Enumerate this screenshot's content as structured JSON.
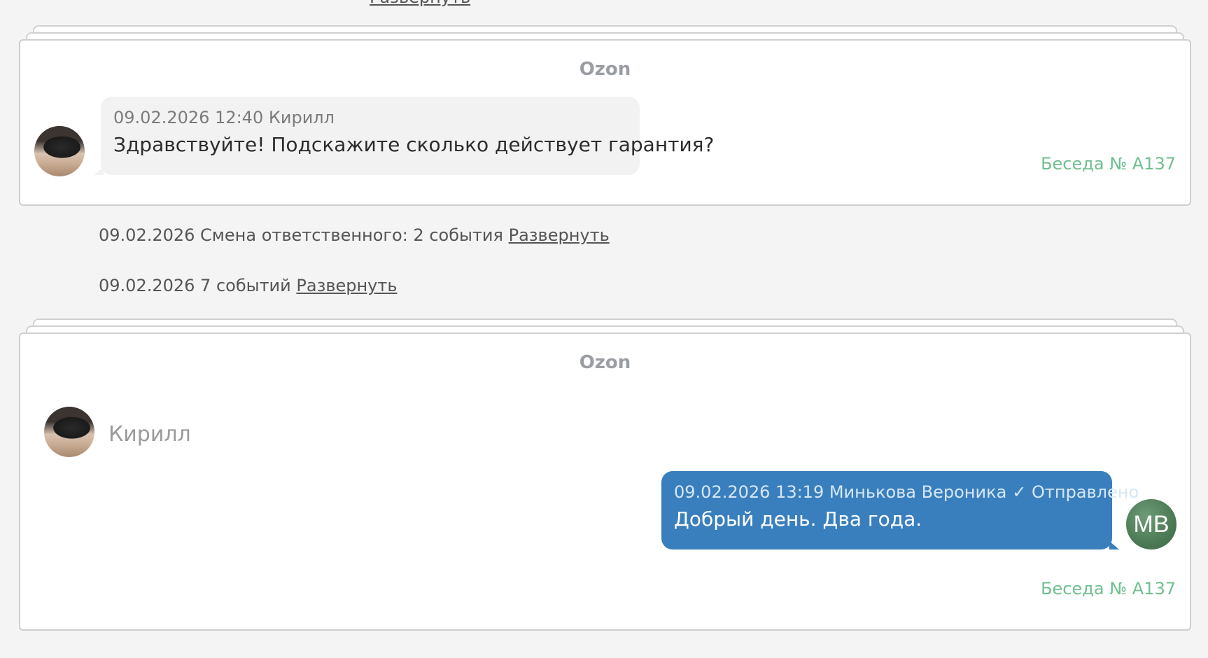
{
  "top_event": {
    "text": "…",
    "expand_label": "Развернуть"
  },
  "card1": {
    "channel": "Ozon",
    "message": {
      "meta": "09.02.2026 12:40 Кирилл",
      "text": "Здравствуйте! Подскажите сколько действует гарантия?"
    },
    "conversation": "Беседа № А137"
  },
  "events": [
    {
      "text": "09.02.2026 Смена ответственного: 2 события",
      "expand_label": "Развернуть"
    },
    {
      "text": "09.02.2026 7 событий",
      "expand_label": "Развернуть"
    }
  ],
  "card2": {
    "channel": "Ozon",
    "author": "Кирилл",
    "message": {
      "meta": "09.02.2026 13:19 Минькова Вероника",
      "status": "✓ Отправлено",
      "text": "Добрый день. Два года.",
      "avatar_initials": "МВ"
    },
    "conversation": "Беседа № А137"
  },
  "colors": {
    "outgoing_bubble": "#3a7fbd",
    "incoming_bubble": "#f2f2f2",
    "conversation_link": "#6fbf8e",
    "background": "#f4f4f4"
  }
}
